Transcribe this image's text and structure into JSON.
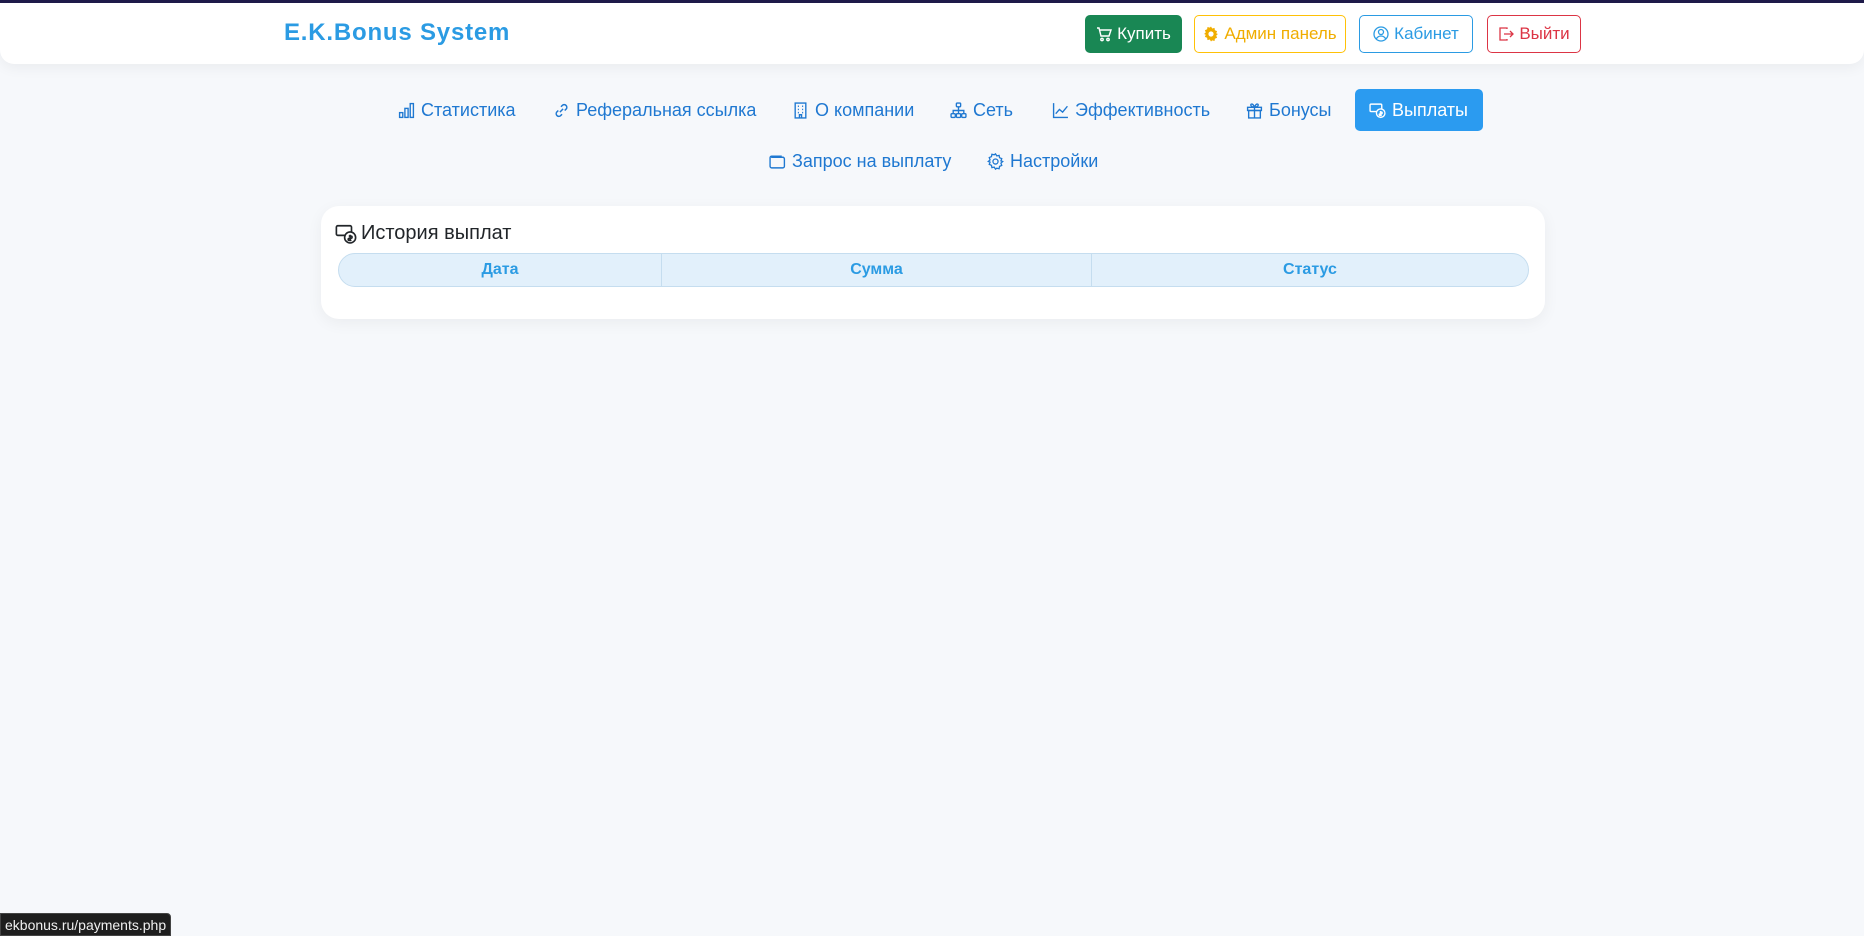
{
  "brand": "E.K.Bonus System",
  "header_buttons": {
    "buy": "Купить",
    "admin": "Админ панель",
    "cabinet": "Кабинет",
    "logout": "Выйти"
  },
  "nav": {
    "row1": [
      {
        "label": "Статистика",
        "icon": "bar-chart-icon"
      },
      {
        "label": "Реферальная ссылка",
        "icon": "link-icon"
      },
      {
        "label": "О компании",
        "icon": "building-icon"
      },
      {
        "label": "Сеть",
        "icon": "network-icon"
      },
      {
        "label": "Эффективность",
        "icon": "line-chart-icon"
      },
      {
        "label": "Бонусы",
        "icon": "gift-icon"
      },
      {
        "label": "Выплаты",
        "icon": "cash-coin-icon",
        "active": true
      }
    ],
    "row2": [
      {
        "label": "Запрос на выплату",
        "icon": "wallet-icon"
      },
      {
        "label": "Настройки",
        "icon": "gear-icon"
      }
    ]
  },
  "card": {
    "title": "История выплат",
    "columns": [
      "Дата",
      "Сумма",
      "Статус"
    ],
    "rows": []
  },
  "status_url": "ekbonus.ru/payments.php",
  "colors": {
    "accent": "#2b9be3",
    "buy": "#198754",
    "admin": "#ffc107",
    "logout": "#dc3545",
    "active_tab": "#2b9bf0"
  }
}
